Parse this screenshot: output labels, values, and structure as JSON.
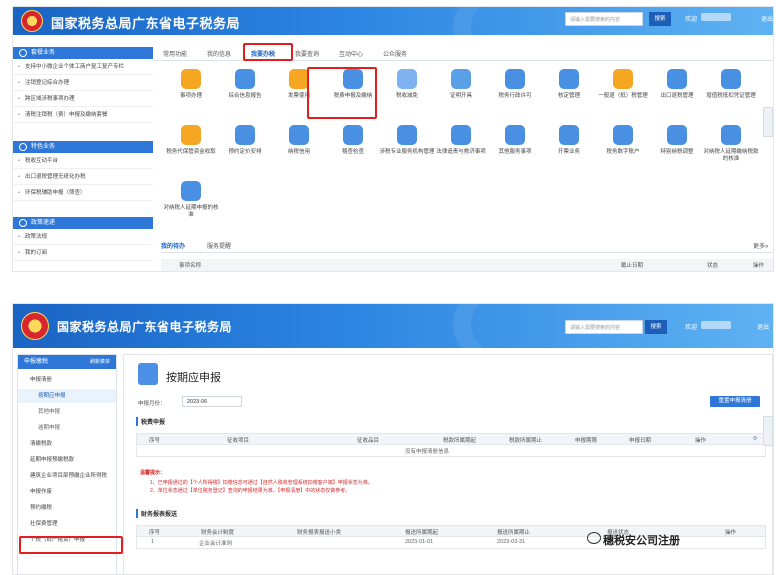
{
  "brand_title": "国家税务总局广东省电子税务局",
  "search": {
    "placeholder": "请输入需要搜索的内容",
    "button": "搜索"
  },
  "greeting": "欢迎",
  "logout": "退出",
  "top": {
    "sidebar": [
      {
        "group": "套餐业务",
        "items": [
          "支持中小微企业个体工商户复工复产专栏",
          "注销登记综合办理",
          "跨区域涉税事项办理",
          "清税注销税（费）申报及缴纳套餐"
        ]
      },
      {
        "group": "特色业务",
        "items": [
          "税收互动平台",
          "出口退税管理无纸化办税",
          "环保税辅助申报（筛查）"
        ]
      },
      {
        "group": "政策速递",
        "items": [
          "政策法规",
          "我的订阅"
        ]
      }
    ],
    "tabs": [
      "常用功能",
      "我的信息",
      "我要办税",
      "我要查询",
      "互动中心",
      "公众服务"
    ],
    "active_tab": "我要办税",
    "tiles": [
      {
        "label": "事项办理",
        "color": "#f5a623"
      },
      {
        "label": "综合信息报告",
        "color": "#4a90e2"
      },
      {
        "label": "发票使用",
        "color": "#f5a623"
      },
      {
        "label": "税费申报及缴纳",
        "color": "#4a90e2"
      },
      {
        "label": "税收减免",
        "color": "#7fb2f0"
      },
      {
        "label": "证明开具",
        "color": "#5aa0e6"
      },
      {
        "label": "税务行政许可",
        "color": "#4a90e2"
      },
      {
        "label": "核定管理",
        "color": "#4a90e2"
      },
      {
        "label": "一般退（抵）税管理",
        "color": "#f5a623"
      },
      {
        "label": "出口退税管理",
        "color": "#4a90e2"
      },
      {
        "label": "增值税抵扣凭证管理",
        "color": "#4a90e2"
      },
      {
        "label": "税务代保管资金收取",
        "color": "#f5a623"
      },
      {
        "label": "预约定价安排",
        "color": "#4a90e2"
      },
      {
        "label": "纳税信用",
        "color": "#4a90e2"
      },
      {
        "label": "稽查检查",
        "color": "#4a90e2"
      },
      {
        "label": "涉税专业服务机构管理",
        "color": "#4a90e2"
      },
      {
        "label": "法律追责与救济事项",
        "color": "#4a90e2"
      },
      {
        "label": "其他服务事项",
        "color": "#4a90e2"
      },
      {
        "label": "开票业务",
        "color": "#4a90e2"
      },
      {
        "label": "税务数字账户",
        "color": "#4a90e2"
      },
      {
        "label": "特别纳税调整",
        "color": "#4a90e2"
      },
      {
        "label": "对纳税人延期缴纳税款的核准",
        "color": "#4a90e2"
      },
      {
        "label": "对纳税人延期申报的核准",
        "color": "#4a90e2"
      }
    ],
    "todo_tabs": [
      "我的待办",
      "服务提醒"
    ],
    "more": "更多»",
    "todo_columns": [
      "事项名称",
      "截止日期",
      "状态",
      "操作"
    ]
  },
  "bottom": {
    "sidebar_head": "申报缴税",
    "sidebar_refresh": "刷新菜单",
    "sidebar_items": [
      {
        "label": "申报清册",
        "sub": false
      },
      {
        "label": "按期应申报",
        "sub": true,
        "active": true
      },
      {
        "label": "其他申报",
        "sub": true
      },
      {
        "label": "逾期申报",
        "sub": true
      },
      {
        "label": "清缴税款",
        "sub": false
      },
      {
        "label": "延期申报预缴税款",
        "sub": false
      },
      {
        "label": "建筑企业项目部预缴企业所得税",
        "sub": false
      },
      {
        "label": "申报作废",
        "sub": false
      },
      {
        "label": "预约缴税",
        "sub": false
      },
      {
        "label": "社保费管理",
        "sub": false
      },
      {
        "label": "个税（财产租赁）申报",
        "sub": false
      }
    ],
    "page_title": "按期应申报",
    "period_label": "申报月份：",
    "period_value": "2023-06",
    "reset_button": "重置申报清册",
    "tax_section": "税费申报",
    "tax_columns": [
      "序号",
      "征收项目",
      "征收品目",
      "税款所属期起",
      "税款所属期止",
      "申报期限",
      "申报日期",
      "操作"
    ],
    "tax_empty": "没有申报清册信息",
    "notice_title": "温馨提示：",
    "notices": [
      "1、已申报通过的【个人所得税】扣缴信息可通过【自然人税收管理系统扣缴客户端】申报状态为准。",
      "2、单位状态通过【单位税务登记】查询的申报结果为准，【申报清册】中的状态仅做参考。"
    ],
    "fin_section": "财务报表报送",
    "fin_columns": [
      "序号",
      "财务会计制度",
      "财务报表报送小类",
      "报送所属期起",
      "报送所属期止",
      "报送状态",
      "操作"
    ],
    "fin_rows": [
      [
        "1",
        "企业会计准则",
        "",
        "2023-01-01",
        "2023-03-31"
      ]
    ]
  },
  "watermark": "穗税安公司注册"
}
